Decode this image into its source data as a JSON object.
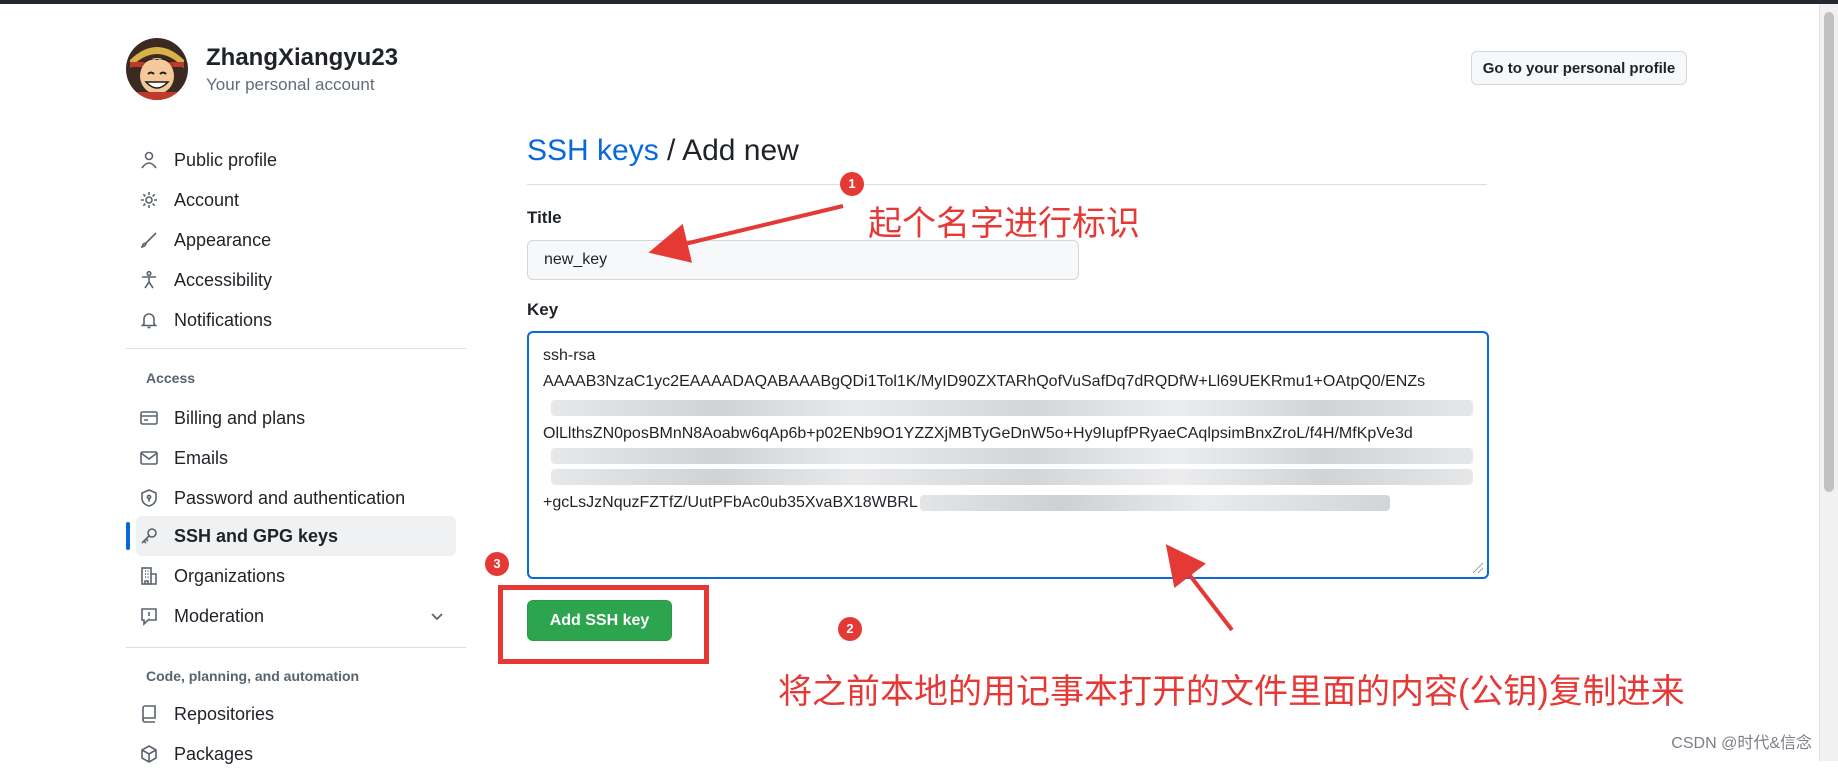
{
  "account": {
    "name": "ZhangXiangyu23",
    "subtitle": "Your personal account",
    "profile_button": "Go to your personal profile"
  },
  "sidebar": {
    "items": [
      {
        "label": "Public profile",
        "icon": "person-icon"
      },
      {
        "label": "Account",
        "icon": "gear-icon"
      },
      {
        "label": "Appearance",
        "icon": "paintbrush-icon"
      },
      {
        "label": "Accessibility",
        "icon": "accessibility-icon"
      },
      {
        "label": "Notifications",
        "icon": "bell-icon"
      }
    ],
    "access_heading": "Access",
    "access_items": [
      {
        "label": "Billing and plans",
        "icon": "credit-card-icon"
      },
      {
        "label": "Emails",
        "icon": "mail-icon"
      },
      {
        "label": "Password and authentication",
        "icon": "shield-lock-icon"
      },
      {
        "label": "SSH and GPG keys",
        "icon": "key-icon",
        "active": true
      },
      {
        "label": "Organizations",
        "icon": "organization-icon"
      },
      {
        "label": "Moderation",
        "icon": "report-icon"
      }
    ],
    "code_heading": "Code, planning, and automation",
    "code_items": [
      {
        "label": "Repositories",
        "icon": "repo-icon"
      },
      {
        "label": "Packages",
        "icon": "package-icon"
      }
    ]
  },
  "main": {
    "breadcrumb_link": "SSH keys",
    "breadcrumb_sep": " / ",
    "breadcrumb_current": "Add new",
    "title_label": "Title",
    "title_value": "new_key",
    "key_label": "Key",
    "key_lines": [
      "ssh-rsa",
      "AAAAB3NzaC1yc2EAAAADAQABAAABgQDi1Tol1K/MyID90ZXTARhQofVuSafDq7dRQDfW+Ll69UEKRmu1+OAtpQ0/ENZs",
      "OlLlthsZN0posBMnN8Aoabw6qAp6b+p02ENb9O1YZZXjMBTyGeDnW5o+Hy9IupfPRyaeCAqlpsimBnxZroL/f4H/MfKpVe3d",
      "+gcLsJzNquzFZTfZ/UutPFbAc0ub35XvaBX18WBRL"
    ],
    "add_button": "Add SSH key"
  },
  "annotations": {
    "n1": "1",
    "n2": "2",
    "n3": "3",
    "text1": "起个名字进行标识",
    "text2": "将之前本地的用记事本打开的文件里面的内容(公钥)复制进来",
    "color": "#e53935"
  },
  "watermark": "CSDN @时代&信念",
  "colors": {
    "link": "#0969da",
    "primary_button": "#2da44e",
    "active_indicator": "#0969da"
  }
}
